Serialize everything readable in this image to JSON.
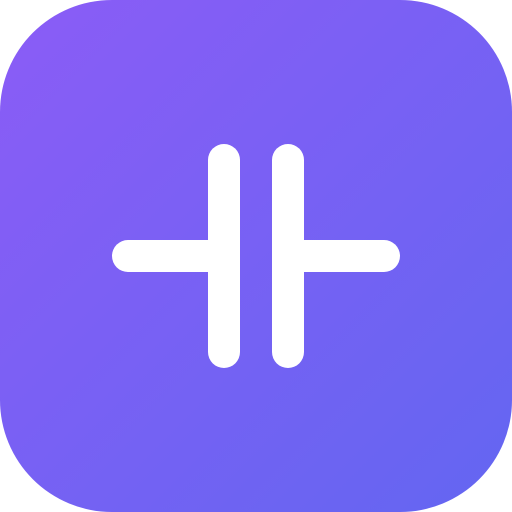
{
  "icon": {
    "glyph": "capacitor-icon",
    "colors": {
      "gradient_start": "#8B5CF6",
      "gradient_end": "#6366F1",
      "glyph": "#FFFFFF"
    }
  }
}
